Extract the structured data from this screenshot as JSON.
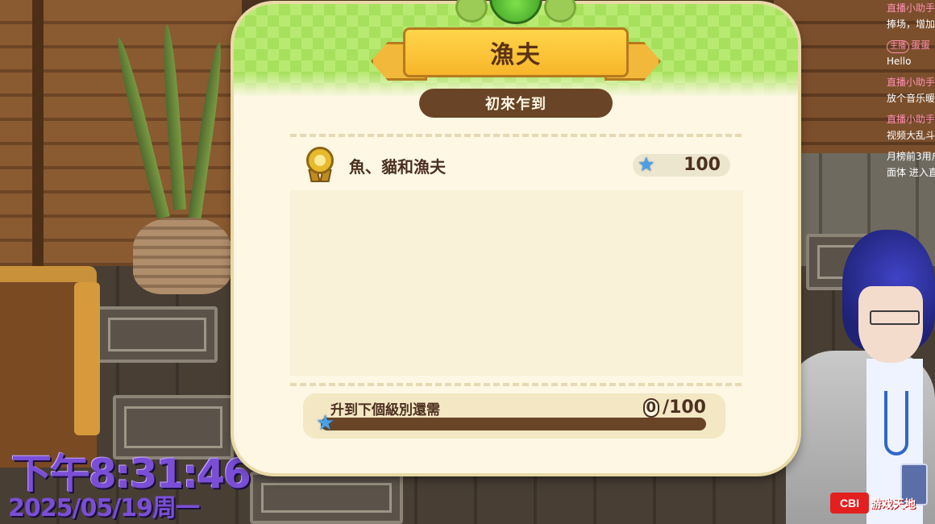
{
  "dialog": {
    "title": "漁夫",
    "rank": "初來乍到",
    "tasks": [
      {
        "name": "魚、貓和漁夫",
        "reward": "100",
        "icon": "medal-icon"
      }
    ],
    "progress": {
      "label": "升到下個級別還需",
      "current": "0",
      "total": "/100",
      "fraction": 0
    }
  },
  "chat": {
    "messages": [
      {
        "sender": "直播小助手",
        "text": "捧场，增加"
      },
      {
        "sender": "蛋蛋",
        "host_badge": "主播",
        "text": "Hello"
      },
      {
        "sender": "直播小助手",
        "text": "放个音乐暖"
      },
      {
        "sender": "直播小助手",
        "text": "视频大乱斗"
      },
      {
        "sender": "",
        "text": "月榜前3用户"
      },
      {
        "sender": "",
        "text": "面体 进入直"
      }
    ]
  },
  "clock": {
    "time": "下午8:31:46",
    "date": "2025/05/19周一"
  },
  "watermark": {
    "logo": "CBI",
    "text": "游戏天地"
  },
  "colors": {
    "header_green": "#b8ea72",
    "ribbon_gold": "#f7b52a",
    "pill_brown": "#6a4426",
    "panel_cream": "#fdf7e4",
    "star_blue": "#4aa0e6",
    "clock_purple": "#7a4fd6"
  }
}
